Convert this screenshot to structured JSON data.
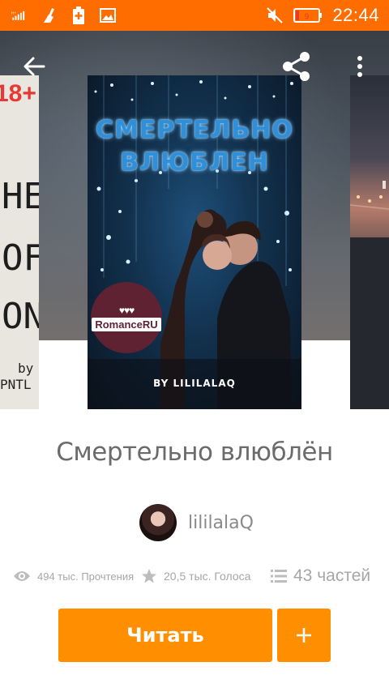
{
  "status_bar": {
    "time": "22:44",
    "battery_level": "9",
    "icons": [
      "signal-icon",
      "cleaner-icon",
      "battery-saver-icon",
      "image-icon",
      "mute-icon",
      "battery-icon"
    ]
  },
  "toolbar": {
    "back_icon": "arrow-left-icon",
    "share_icon": "share-icon",
    "more_icon": "more-vertical-icon"
  },
  "cover": {
    "title_line1": "СМЕРТЕЛЬНО",
    "title_line2": "ВЛЮБЛЕН",
    "badge_hearts": "♥♥♥",
    "badge_brand": "RomanceRU",
    "by_line": "BY LILILALAQ"
  },
  "left_cover": {
    "badge": "18+",
    "line1": "HE",
    "line2": "OF",
    "line3": "ON",
    "by": "by",
    "author": "PNTL"
  },
  "book": {
    "title": "Смертельно влюблён",
    "author": "lililalaQ"
  },
  "stats": {
    "reads": "494 тыс. Прочтения",
    "votes": "20,5 тыс. Голоса",
    "parts": "43 частей"
  },
  "actions": {
    "read_label": "Читать",
    "add_label": "+"
  },
  "colors": {
    "accent": "#ff8f00",
    "status_bar": "#ff6d00"
  }
}
